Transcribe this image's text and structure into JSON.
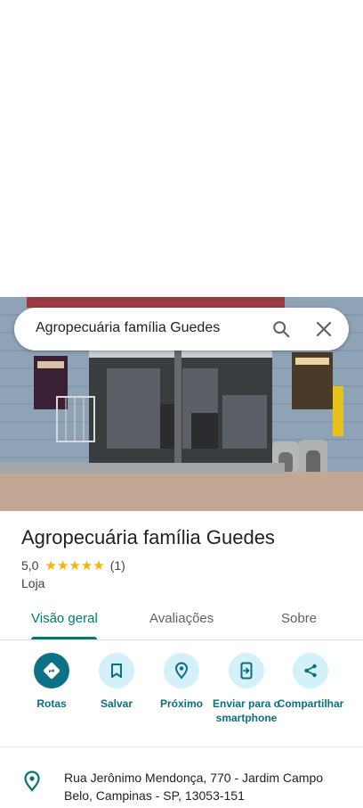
{
  "search": {
    "query": "Agropecuária família Guedes"
  },
  "place": {
    "name": "Agropecuária família Guedes",
    "rating": "5,0",
    "stars": "★★★★★",
    "review_count": "(1)",
    "category": "Loja",
    "photo_signs": {
      "left_poster": "Billy Cat",
      "right_poster": "Billy Dog"
    }
  },
  "tabs": [
    {
      "label": "Visão geral",
      "active": true
    },
    {
      "label": "Avaliações",
      "active": false
    },
    {
      "label": "Sobre",
      "active": false
    }
  ],
  "actions": [
    {
      "label": "Rotas",
      "icon": "directions-icon"
    },
    {
      "label": "Salvar",
      "icon": "bookmark-icon"
    },
    {
      "label": "Próximo",
      "icon": "nearby-icon"
    },
    {
      "label": "Enviar para o smartphone",
      "icon": "send-to-phone-icon"
    },
    {
      "label": "Compartilhar",
      "icon": "share-icon"
    }
  ],
  "address": {
    "text": "Rua Jerônimo Mendonça, 770 - Jardim Campo Belo, Campinas - SP, 13053-151",
    "icon": "location-pin-icon"
  },
  "colors": {
    "accent": "#00796b",
    "action_primary": "#0c7184",
    "action_secondary_bg": "#d4f1f9",
    "star": "#f4b400"
  }
}
